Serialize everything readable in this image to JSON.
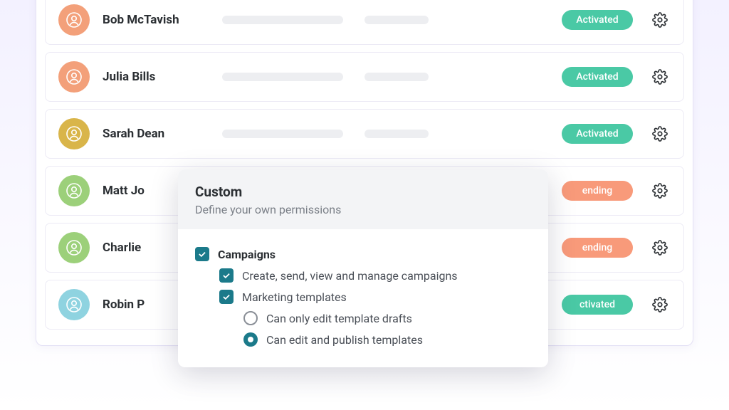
{
  "users": [
    {
      "name": "Bob McTavish",
      "status_label": "Activated",
      "status": "activated",
      "avatar_color": "#f3a07a"
    },
    {
      "name": "Julia Bills",
      "status_label": "Activated",
      "status": "activated",
      "avatar_color": "#f3a07a"
    },
    {
      "name": "Sarah Dean",
      "status_label": "Activated",
      "status": "activated",
      "avatar_color": "#d9b54a"
    },
    {
      "name": "Matt Jo",
      "status_label": "ending",
      "status": "pending",
      "avatar_color": "#9cd07a"
    },
    {
      "name": "Charlie",
      "status_label": "ending",
      "status": "pending",
      "avatar_color": "#9cd07a"
    },
    {
      "name": "Robin P",
      "status_label": "ctivated",
      "status": "activated",
      "avatar_color": "#8fd3e0"
    }
  ],
  "popover": {
    "title": "Custom",
    "subtitle": "Define your own permissions",
    "group_label": "Campaigns",
    "perm1": "Create, send, view and manage campaigns",
    "perm2": "Marketing templates",
    "radio1": "Can only edit template drafts",
    "radio2": "Can edit and publish templates"
  }
}
